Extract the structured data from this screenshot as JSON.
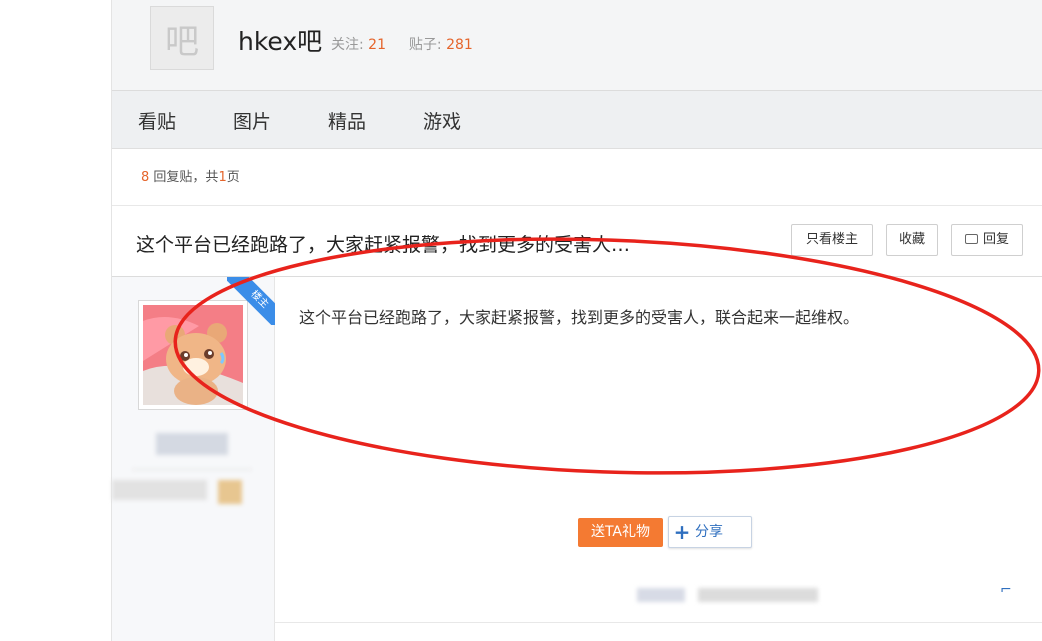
{
  "forum": {
    "logo_char": "吧",
    "name": "hkex吧",
    "follow_label": "关注:",
    "follow_count": "21",
    "posts_label": "贴子:",
    "posts_count": "281"
  },
  "nav": {
    "tabs": [
      "看贴",
      "图片",
      "精品",
      "游戏"
    ]
  },
  "replies": {
    "count": "8",
    "middle": "回复贴，共",
    "pages": "1",
    "suffix": "页"
  },
  "thread": {
    "title": "这个平台已经跑路了，大家赶紧报警，找到更多的受害人…",
    "only_author_label": "只看楼主",
    "favorite_label": "收藏",
    "reply_label": "回复"
  },
  "post": {
    "badge": "楼主",
    "content": "这个平台已经跑路了，大家赶紧报警，找到更多的受害人，联合起来一起维权。",
    "gift_label": "送TA礼物",
    "share_label": "分享"
  },
  "colors": {
    "accent_orange": "#e5652c",
    "gift_orange": "#f47a32",
    "annotation_red": "#e8231c",
    "badge_blue": "#3b8de8"
  }
}
